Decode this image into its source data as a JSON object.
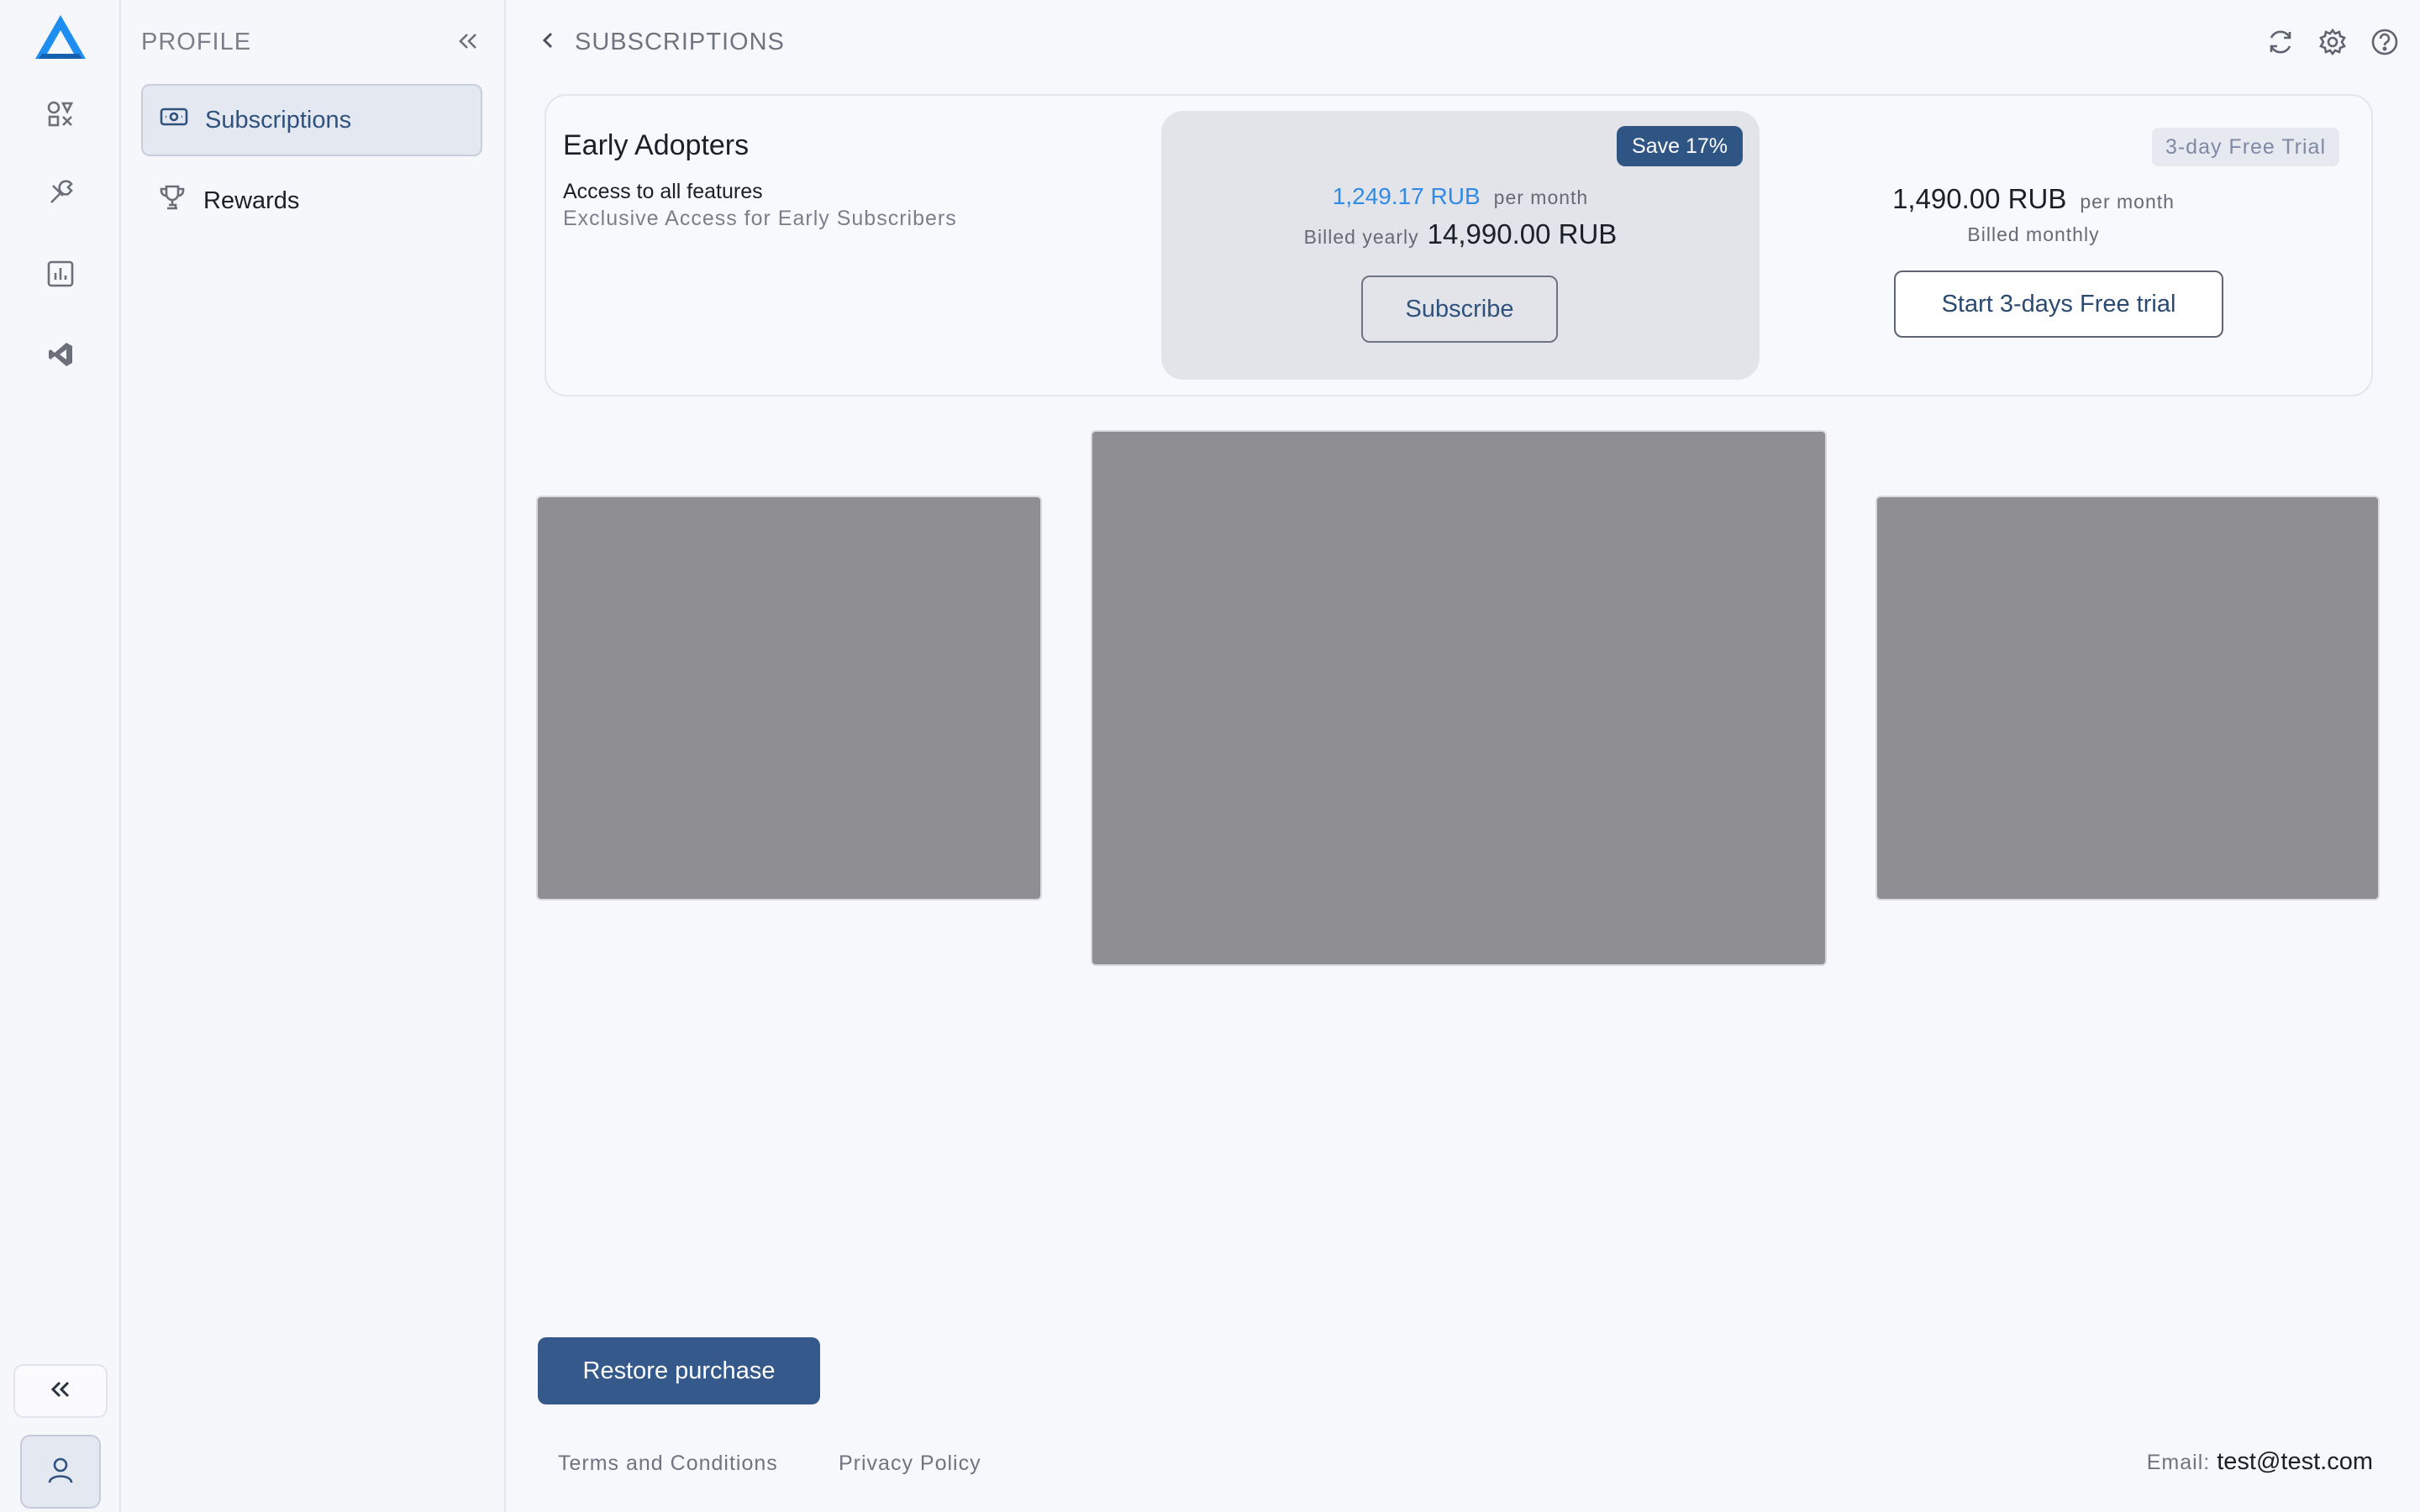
{
  "app": {
    "icons": {
      "logo": "app-logo-triangle",
      "nav": [
        "shapes-icon",
        "tools-icon",
        "chart-icon",
        "vscode-icon"
      ],
      "collapse": "double-chevron-left-icon",
      "profile": "user-icon"
    }
  },
  "sidebar": {
    "title": "PROFILE",
    "items": [
      {
        "label": "Subscriptions",
        "icon": "money-icon",
        "active": true
      },
      {
        "label": "Rewards",
        "icon": "trophy-icon",
        "active": false
      }
    ]
  },
  "header": {
    "title": "SUBSCRIPTIONS",
    "icons": [
      "refresh-icon",
      "gear-icon",
      "help-icon"
    ]
  },
  "plan": {
    "name": "Early Adopters",
    "feature": "Access to all features",
    "feature_sub": "Exclusive Access for Early Subscribers",
    "yearly": {
      "badge": "Save 17%",
      "price_monthly": "1,249.17 RUB",
      "per_month": "per month",
      "billed_label": "Billed yearly",
      "billed_total": "14,990.00 RUB",
      "button": "Subscribe"
    },
    "monthly": {
      "badge": "3-day Free Trial",
      "price": "1,490.00 RUB",
      "per_month": "per month",
      "billed": "Billed monthly",
      "button": "Start 3-days Free trial"
    }
  },
  "footer": {
    "restore_button": "Restore purchase",
    "terms": "Terms and Conditions",
    "privacy": "Privacy Policy",
    "email_label": "Email:",
    "email_value": "test@test.com"
  },
  "colors": {
    "accent": "#34598a",
    "link_blue": "#2f8be6",
    "placeholder_gray": "#8f8f93"
  }
}
